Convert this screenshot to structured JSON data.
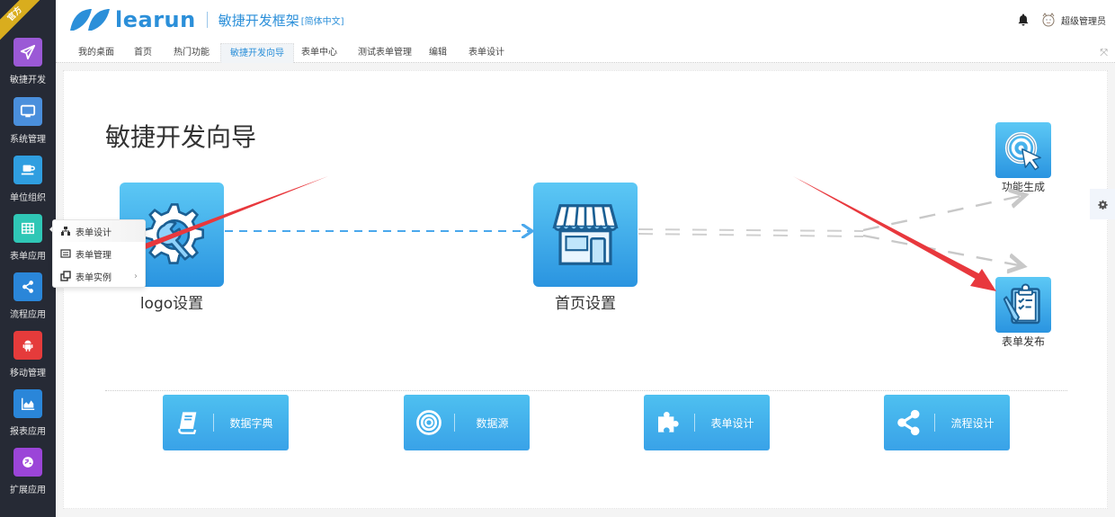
{
  "ribbon": {
    "label": "官方"
  },
  "sidebar": {
    "items": [
      {
        "label": "敏捷开发",
        "icon": "paper-plane-icon",
        "color": "#9b59d6"
      },
      {
        "label": "系统管理",
        "icon": "monitor-icon",
        "color": "#4a8fdc"
      },
      {
        "label": "单位组织",
        "icon": "coffee-cup-icon",
        "color": "#2f9ee0"
      },
      {
        "label": "表单应用",
        "icon": "table-grid-icon",
        "color": "#2fc7b6"
      },
      {
        "label": "流程应用",
        "icon": "share-icon",
        "color": "#2a86d9"
      },
      {
        "label": "移动管理",
        "icon": "android-icon",
        "color": "#e53b3b"
      },
      {
        "label": "报表应用",
        "icon": "area-chart-icon",
        "color": "#2a86d9"
      },
      {
        "label": "扩展应用",
        "icon": "globe-icon",
        "color": "#9b45d8"
      }
    ]
  },
  "header": {
    "brand": "learun",
    "subtitle": "敏捷开发框架",
    "language": "[简体中文]",
    "user_name": "超级管理员",
    "brand_color": "#2b8fd9"
  },
  "tabs": [
    {
      "label": "我的桌面",
      "active": false
    },
    {
      "label": "首页",
      "active": false
    },
    {
      "label": "热门功能",
      "active": false
    },
    {
      "label": "敏捷开发向导",
      "active": true
    },
    {
      "label": "表单中心",
      "active": false
    },
    {
      "label": "测试表单管理",
      "active": false
    },
    {
      "label": "编辑",
      "active": false
    },
    {
      "label": "表单设计",
      "active": false
    }
  ],
  "main": {
    "title": "敏捷开发向导",
    "flow": {
      "logo": {
        "label": "logo设置",
        "icon": "gear-wrench-icon"
      },
      "home": {
        "label": "首页设置",
        "icon": "storefront-icon"
      },
      "func": {
        "label": "功能生成",
        "icon": "target-cursor-icon"
      },
      "form": {
        "label": "表单发布",
        "icon": "clipboard-icon"
      }
    },
    "buttons": [
      {
        "label": "数据字典",
        "icon": "book-icon"
      },
      {
        "label": "数据源",
        "icon": "concentric-circles-icon"
      },
      {
        "label": "表单设计",
        "icon": "puzzle-icon"
      },
      {
        "label": "流程设计",
        "icon": "share-icon"
      }
    ]
  },
  "popup": {
    "items": [
      {
        "label": "表单设计",
        "icon": "sitemap-icon",
        "has_submenu": false
      },
      {
        "label": "表单管理",
        "icon": "list-window-icon",
        "has_submenu": false
      },
      {
        "label": "表单实例",
        "icon": "clone-icon",
        "has_submenu": true
      }
    ],
    "submenu_arrow": "›"
  },
  "colors": {
    "sidebar_bg": "#262a35",
    "tile_blue": "#2a94e0",
    "annotation_arrow": "#e8383d"
  }
}
